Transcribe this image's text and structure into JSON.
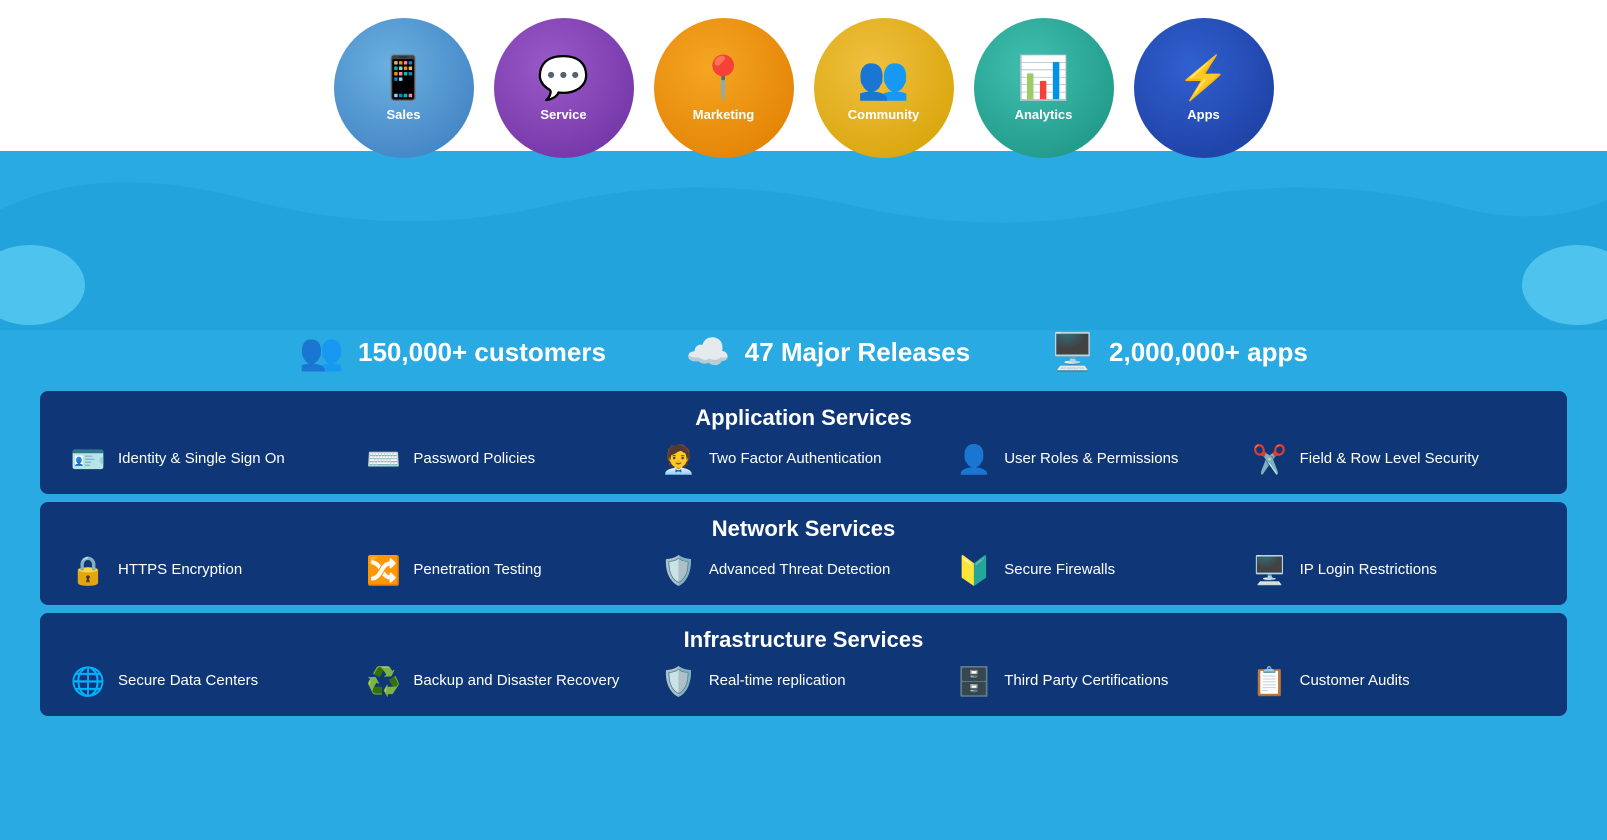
{
  "background": {
    "topColor": "#ffffff",
    "bottomColor": "#29aae2"
  },
  "circles": [
    {
      "id": "sales",
      "label": "Sales",
      "colorClass": "circle-sales",
      "icon": "📱"
    },
    {
      "id": "service",
      "label": "Service",
      "colorClass": "circle-service",
      "icon": "💬"
    },
    {
      "id": "marketing",
      "label": "Marketing",
      "colorClass": "circle-marketing",
      "icon": "📍"
    },
    {
      "id": "community",
      "label": "Community",
      "colorClass": "circle-community",
      "icon": "👥"
    },
    {
      "id": "analytics",
      "label": "Analytics",
      "colorClass": "circle-analytics",
      "icon": "📊"
    },
    {
      "id": "apps",
      "label": "Apps",
      "colorClass": "circle-apps",
      "icon": "⚡"
    }
  ],
  "stats": [
    {
      "id": "customers",
      "icon": "👥",
      "text": "150,000+ customers"
    },
    {
      "id": "releases",
      "icon": "☁️",
      "text": "47 Major Releases"
    },
    {
      "id": "apps",
      "icon": "🖥️",
      "text": "2,000,000+ apps"
    }
  ],
  "panels": [
    {
      "id": "application",
      "title": "Application Services",
      "items": [
        {
          "id": "identity",
          "icon": "🪪",
          "text": "Identity & Single Sign On"
        },
        {
          "id": "password",
          "icon": "⌨️",
          "text": "Password Policies"
        },
        {
          "id": "twofactor",
          "icon": "🧑‍💼",
          "text": "Two Factor Authentication"
        },
        {
          "id": "userroles",
          "icon": "👤",
          "text": "User Roles & Permissions"
        },
        {
          "id": "fieldrow",
          "icon": "✂️",
          "text": "Field & Row Level Security"
        }
      ]
    },
    {
      "id": "network",
      "title": "Network Services",
      "items": [
        {
          "id": "https",
          "icon": "🔒",
          "text": "HTTPS Encryption"
        },
        {
          "id": "penetration",
          "icon": "🔀",
          "text": "Penetration Testing"
        },
        {
          "id": "threat",
          "icon": "🛡️",
          "text": "Advanced Threat Detection"
        },
        {
          "id": "firewalls",
          "icon": "🔰",
          "text": "Secure Firewalls"
        },
        {
          "id": "iplogin",
          "icon": "🖥️",
          "text": "IP Login Restrictions"
        }
      ]
    },
    {
      "id": "infrastructure",
      "title": "Infrastructure Services",
      "items": [
        {
          "id": "datacenters",
          "icon": "🌐",
          "text": "Secure Data Centers"
        },
        {
          "id": "backup",
          "icon": "♻️",
          "text": "Backup and Disaster Recovery"
        },
        {
          "id": "realtime",
          "icon": "🛡️",
          "text": "Real-time replication"
        },
        {
          "id": "thirdparty",
          "icon": "🗄️",
          "text": "Third Party Certifications"
        },
        {
          "id": "audits",
          "icon": "📋",
          "text": "Customer Audits"
        }
      ]
    }
  ]
}
